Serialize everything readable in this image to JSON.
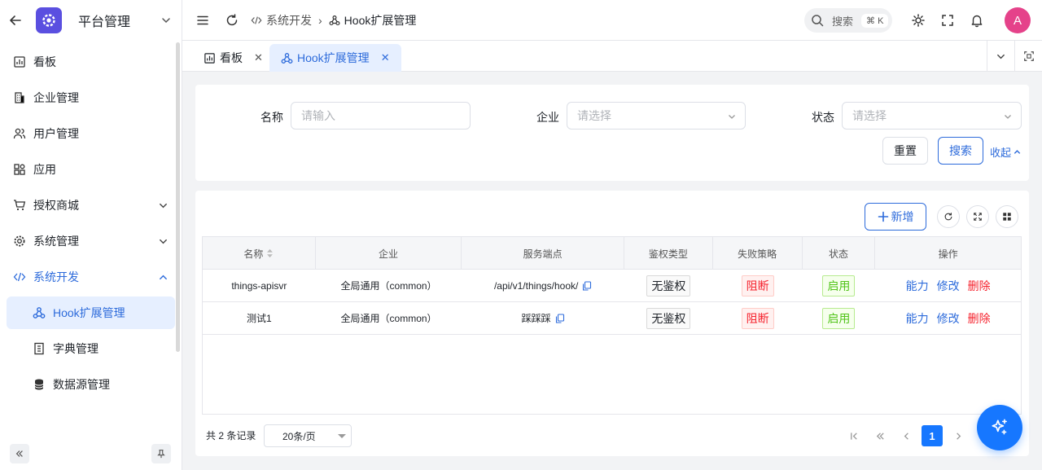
{
  "sidebar": {
    "title": "平台管理",
    "items": [
      {
        "label": "看板"
      },
      {
        "label": "企业管理"
      },
      {
        "label": "用户管理"
      },
      {
        "label": "应用"
      },
      {
        "label": "授权商城"
      },
      {
        "label": "系统管理"
      },
      {
        "label": "系统开发"
      },
      {
        "label": "Hook扩展管理"
      },
      {
        "label": "字典管理"
      },
      {
        "label": "数据源管理"
      }
    ]
  },
  "header": {
    "breadcrumb": [
      "系统开发",
      "Hook扩展管理"
    ],
    "search_label": "搜索",
    "search_kbd": "⌘ K",
    "avatar": "A"
  },
  "tabs": [
    {
      "label": "看板"
    },
    {
      "label": "Hook扩展管理"
    }
  ],
  "filters": {
    "name_label": "名称",
    "name_placeholder": "请输入",
    "company_label": "企业",
    "company_placeholder": "请选择",
    "status_label": "状态",
    "status_placeholder": "请选择",
    "reset": "重置",
    "search": "搜索",
    "collapse": "收起"
  },
  "toolbar": {
    "add": "新增"
  },
  "table": {
    "columns": [
      "名称",
      "企业",
      "服务端点",
      "鉴权类型",
      "失败策略",
      "状态",
      "操作"
    ],
    "rows": [
      {
        "name": "things-apisvr",
        "company": "全局通用（common）",
        "endpoint": "/api/v1/things/hook/",
        "auth": "无鉴权",
        "fail": "阻断",
        "status": "启用",
        "op1": "能力",
        "op2": "修改",
        "op3": "删除"
      },
      {
        "name": "测试1",
        "company": "全局通用（common）",
        "endpoint": "踩踩踩",
        "auth": "无鉴权",
        "fail": "阻断",
        "status": "启用",
        "op1": "能力",
        "op2": "修改",
        "op3": "删除"
      }
    ]
  },
  "pager": {
    "total": "共 2 条记录",
    "page_size": "20条/页",
    "current": "1"
  }
}
